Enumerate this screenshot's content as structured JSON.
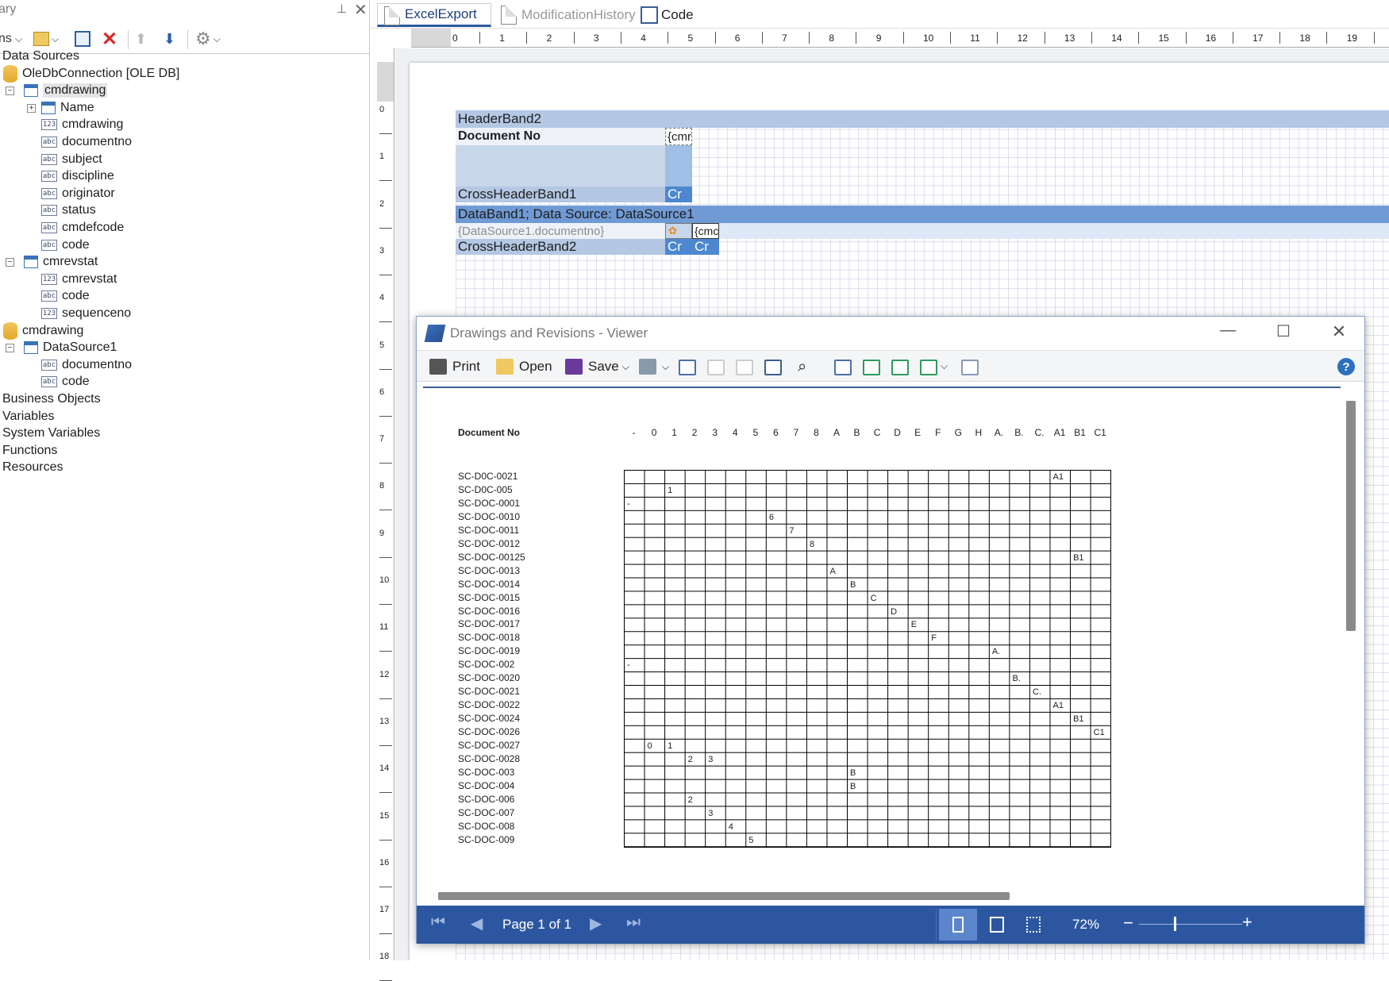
{
  "left_panel": {
    "title": "ary",
    "toolbar_label": "ns",
    "tree": [
      {
        "label": "Data Sources",
        "level": 0,
        "kind": "root"
      },
      {
        "label": "OleDbConnection [OLE DB]",
        "level": 1,
        "kind": "db"
      },
      {
        "label": "cmdrawing",
        "level": 2,
        "kind": "table",
        "selected": true
      },
      {
        "label": "Name",
        "level": 3,
        "kind": "rel"
      },
      {
        "label": "cmdrawing",
        "level": 3,
        "kind": "num"
      },
      {
        "label": "documentno",
        "level": 3,
        "kind": "abc"
      },
      {
        "label": "subject",
        "level": 3,
        "kind": "abc"
      },
      {
        "label": "discipline",
        "level": 3,
        "kind": "abc"
      },
      {
        "label": "originator",
        "level": 3,
        "kind": "abc"
      },
      {
        "label": "status",
        "level": 3,
        "kind": "abc"
      },
      {
        "label": "cmdefcode",
        "level": 3,
        "kind": "abc"
      },
      {
        "label": "code",
        "level": 3,
        "kind": "abc"
      },
      {
        "label": "cmrevstat",
        "level": 2,
        "kind": "table"
      },
      {
        "label": "cmrevstat",
        "level": 3,
        "kind": "num"
      },
      {
        "label": "code",
        "level": 3,
        "kind": "abc"
      },
      {
        "label": "sequenceno",
        "level": 3,
        "kind": "num"
      },
      {
        "label": "cmdrawing",
        "level": 1,
        "kind": "db2"
      },
      {
        "label": "DataSource1",
        "level": 2,
        "kind": "table"
      },
      {
        "label": "documentno",
        "level": 3,
        "kind": "abc"
      },
      {
        "label": "code",
        "level": 3,
        "kind": "abc"
      },
      {
        "label": "Business Objects",
        "level": 0,
        "kind": "root"
      },
      {
        "label": "Variables",
        "level": 0,
        "kind": "root"
      },
      {
        "label": "System Variables",
        "level": 0,
        "kind": "root"
      },
      {
        "label": "Functions",
        "level": 0,
        "kind": "root"
      },
      {
        "label": "Resources",
        "level": 0,
        "kind": "root"
      }
    ]
  },
  "tabs": [
    {
      "label": "ExcelExport",
      "active": true
    },
    {
      "label": "ModificationHistory",
      "active": false
    },
    {
      "label": "Code",
      "active": false
    }
  ],
  "ruler_top": [
    "0",
    "1",
    "2",
    "3",
    "4",
    "5",
    "6",
    "7",
    "8",
    "9",
    "10",
    "11",
    "12",
    "13",
    "14",
    "15",
    "16",
    "17",
    "18",
    "19"
  ],
  "ruler_left": [
    "0",
    "1",
    "2",
    "3",
    "4",
    "5",
    "6",
    "7",
    "8",
    "9",
    "10",
    "11",
    "12",
    "13",
    "14",
    "15",
    "16",
    "17",
    "18"
  ],
  "bands": {
    "header": "HeaderBand2",
    "doc_no": "Document No",
    "cmr_field": "{cmr",
    "cross1": "CrossHeaderBand1",
    "cr1": "Cr",
    "data": "DataBand1; Data Source: DataSource1",
    "ds_field": "{DataSource1.documentno}",
    "cmd_field": "{cmc",
    "cross2": "CrossHeaderBand2",
    "cr2a": "Cr",
    "cr2b": "Cr"
  },
  "viewer": {
    "title": "Drawings and Revisions - Viewer",
    "print": "Print",
    "open": "Open",
    "save": "Save",
    "help": "?",
    "page_label": "Page 1 of 1",
    "zoom": "72%",
    "minus": "−",
    "plus": "+",
    "report": {
      "doc_label": "Document No",
      "columns": [
        "-",
        "0",
        "1",
        "2",
        "3",
        "4",
        "5",
        "6",
        "7",
        "8",
        "A",
        "B",
        "C",
        "D",
        "E",
        "F",
        "G",
        "H",
        "A.",
        "B.",
        "C.",
        "A1",
        "B1",
        "C1"
      ],
      "rows": [
        {
          "doc": "SC-D0C-0021",
          "col": 21,
          "val": "A1"
        },
        {
          "doc": "SC-D0C-005",
          "col": 2,
          "val": "1"
        },
        {
          "doc": "SC-DOC-0001",
          "col": 0,
          "val": "-"
        },
        {
          "doc": "SC-DOC-0010",
          "col": 7,
          "val": "6"
        },
        {
          "doc": "SC-DOC-0011",
          "col": 8,
          "val": "7"
        },
        {
          "doc": "SC-DOC-0012",
          "col": 9,
          "val": "8"
        },
        {
          "doc": "SC-DOC-00125",
          "col": 22,
          "val": "B1"
        },
        {
          "doc": "SC-DOC-0013",
          "col": 10,
          "val": "A"
        },
        {
          "doc": "SC-DOC-0014",
          "col": 11,
          "val": "B"
        },
        {
          "doc": "SC-DOC-0015",
          "col": 12,
          "val": "C"
        },
        {
          "doc": "SC-DOC-0016",
          "col": 13,
          "val": "D"
        },
        {
          "doc": "SC-DOC-0017",
          "col": 14,
          "val": "E"
        },
        {
          "doc": "SC-DOC-0018",
          "col": 15,
          "val": "F"
        },
        {
          "doc": "SC-DOC-0019",
          "col": 18,
          "val": "A."
        },
        {
          "doc": "SC-DOC-002",
          "col": 0,
          "val": "-"
        },
        {
          "doc": "SC-DOC-0020",
          "col": 19,
          "val": "B."
        },
        {
          "doc": "SC-DOC-0021",
          "col": 20,
          "val": "C."
        },
        {
          "doc": "SC-DOC-0022",
          "col": 21,
          "val": "A1"
        },
        {
          "doc": "SC-DOC-0024",
          "col": 22,
          "val": "B1"
        },
        {
          "doc": "SC-DOC-0026",
          "col": 23,
          "val": "C1"
        },
        {
          "doc": "SC-DOC-0027",
          "cells": [
            [
              1,
              "0"
            ],
            [
              2,
              "1"
            ]
          ]
        },
        {
          "doc": "SC-DOC-0028",
          "cells": [
            [
              3,
              "2"
            ],
            [
              4,
              "3"
            ]
          ]
        },
        {
          "doc": "SC-DOC-003",
          "col": 11,
          "val": "B"
        },
        {
          "doc": "SC-DOC-004",
          "col": 11,
          "val": "B"
        },
        {
          "doc": "SC-DOC-006",
          "col": 3,
          "val": "2"
        },
        {
          "doc": "SC-DOC-007",
          "col": 4,
          "val": "3"
        },
        {
          "doc": "SC-DOC-008",
          "col": 5,
          "val": "4"
        },
        {
          "doc": "SC-DOC-009",
          "col": 6,
          "val": "5"
        }
      ]
    }
  },
  "colors": {
    "band_header": "#b4c8e4",
    "band_data": "#6f9ad4",
    "status_bar": "#2c57a0",
    "accent": "#2c57a0"
  }
}
